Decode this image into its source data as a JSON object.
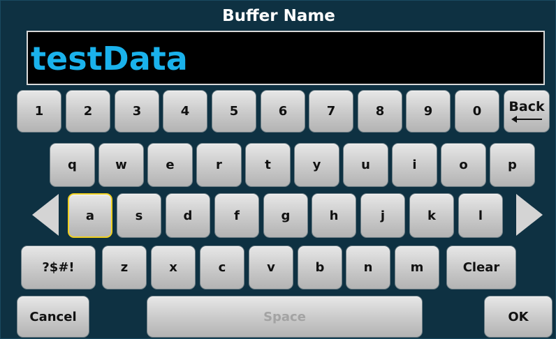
{
  "dialog": {
    "title": "Buffer Name",
    "entry_value": "testData"
  },
  "keyboard": {
    "number_row": [
      "1",
      "2",
      "3",
      "4",
      "5",
      "6",
      "7",
      "8",
      "9",
      "0"
    ],
    "back_label": "Back",
    "row_qwerty": [
      "q",
      "w",
      "e",
      "r",
      "t",
      "y",
      "u",
      "i",
      "o",
      "p"
    ],
    "row_asdf": [
      "a",
      "s",
      "d",
      "f",
      "g",
      "h",
      "j",
      "k",
      "l"
    ],
    "selected_key": "a",
    "symbols_label": "?$#!",
    "row_zxcv": [
      "z",
      "x",
      "c",
      "v",
      "b",
      "n",
      "m"
    ],
    "clear_label": "Clear",
    "cancel_label": "Cancel",
    "space_label": "Space",
    "ok_label": "OK"
  },
  "colors": {
    "background": "#0e3142",
    "entry_text": "#1ab2ec",
    "selection_outline": "#f0d020"
  }
}
